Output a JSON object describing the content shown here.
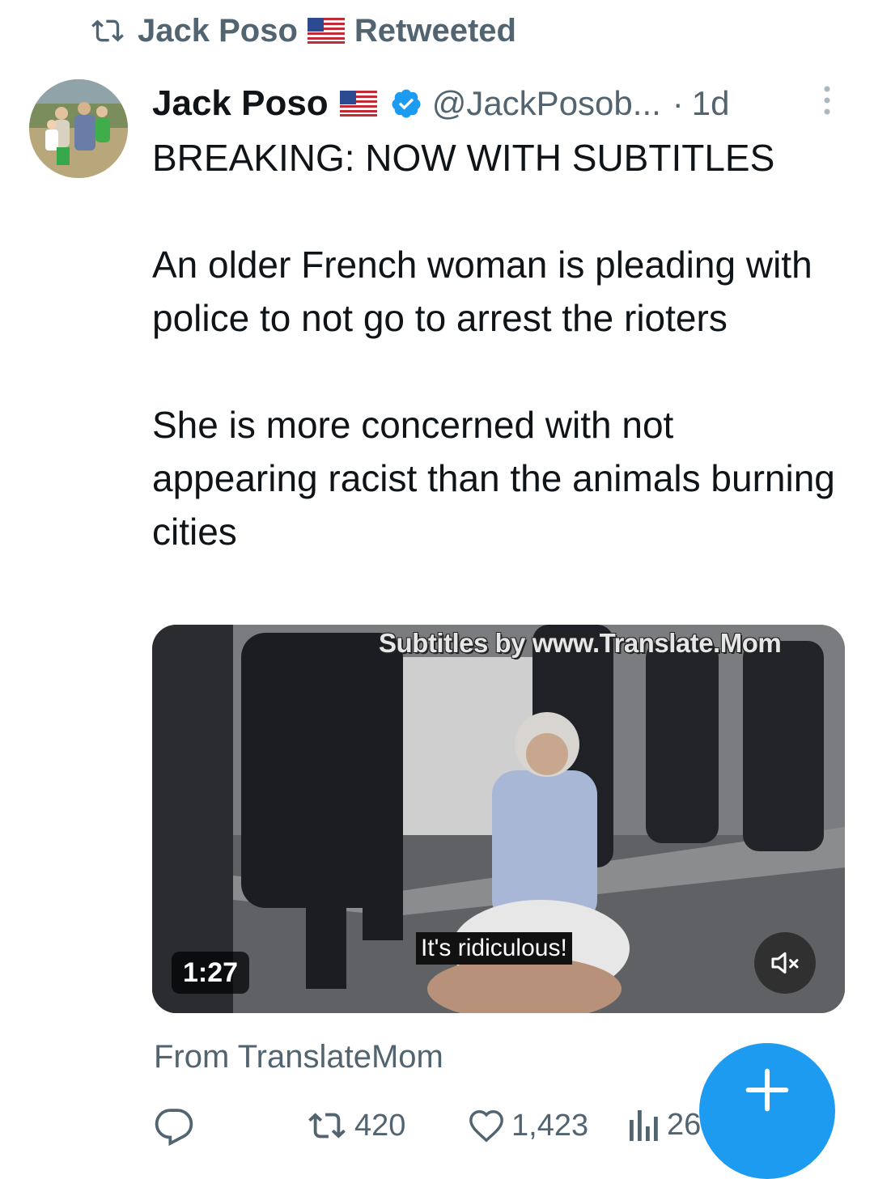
{
  "retweet_bar": {
    "user": "Jack Poso",
    "label": "Retweeted"
  },
  "tweet": {
    "display_name": "Jack Poso",
    "handle": "@JackPosob...",
    "separator": "·",
    "time": "1d",
    "text": "BREAKING: NOW WITH SUBTITLES\n\nAn older French woman is pleading with police to not go to arrest the rioters\n\nShe is more concerned with not appearing racist than the animals burning cities",
    "media": {
      "watermark": "Subtitles by www.Translate.Mom",
      "subtitle": "It's ridiculous!",
      "duration": "1:27",
      "mute_icon": "speaker-muted-icon"
    },
    "source": "From TranslateMom",
    "actions": {
      "retweets": "420",
      "likes": "1,423",
      "views": "26"
    }
  },
  "icons": {
    "retweet": "retweet-icon",
    "verified": "verified-badge-icon",
    "flag": "us-flag-icon",
    "more": "more-vertical-icon",
    "reply": "reply-icon",
    "like": "heart-icon",
    "views": "views-icon",
    "compose": "plus-icon"
  },
  "colors": {
    "accent": "#1d9bf0",
    "muted": "#536471",
    "text": "#0f1419"
  }
}
